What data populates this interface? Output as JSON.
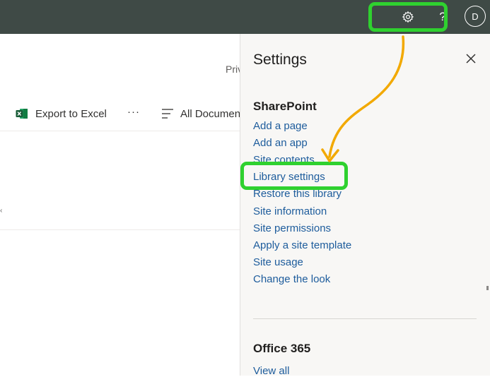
{
  "topbar": {
    "help_glyph": "?",
    "avatar_initial": "D",
    "bg_color": "#3f4a46"
  },
  "page": {
    "privacy_fragment": "Priv",
    "commands": {
      "export_label": "Export to Excel",
      "more_label": "···",
      "view_label": "All Documen"
    }
  },
  "settings": {
    "title": "Settings",
    "sections": [
      {
        "title": "SharePoint",
        "links": [
          "Add a page",
          "Add an app",
          "Site contents",
          "Library settings",
          "Restore this library",
          "Site information",
          "Site permissions",
          "Apply a site template",
          "Site usage",
          "Change the look"
        ]
      },
      {
        "title": "Office 365",
        "links": [
          "View all"
        ]
      }
    ],
    "link_color": "#1d5c9c"
  },
  "annotations": {
    "highlight_color": "#2fd12f",
    "arrow_color": "#f2a900"
  },
  "icons": [
    "gear-icon",
    "help-icon",
    "close-icon",
    "excel-icon",
    "view-options-icon",
    "chevron-left-icon"
  ]
}
